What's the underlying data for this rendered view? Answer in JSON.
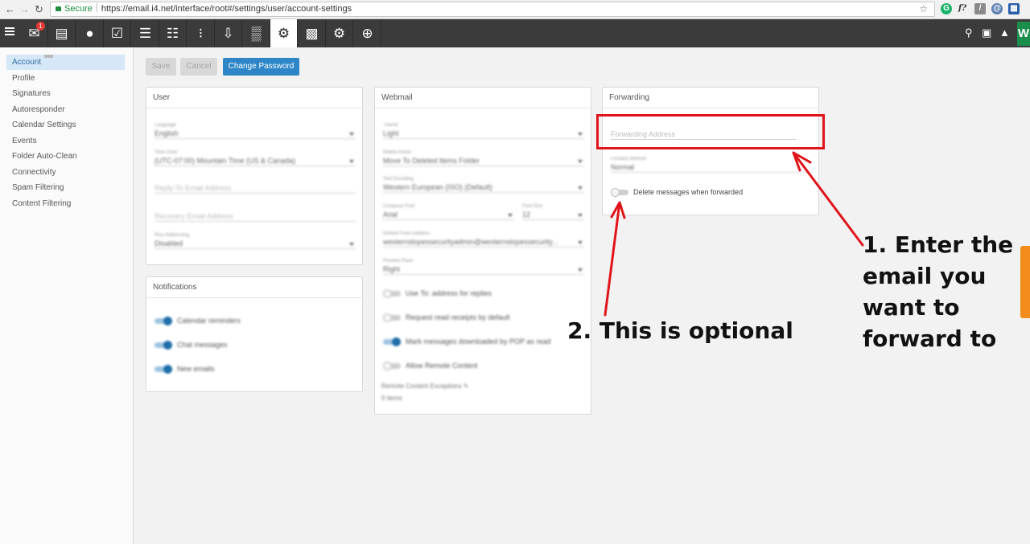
{
  "browser": {
    "secure_label": "Secure",
    "url": "https://email.i4.net/interface/root#/settings/user/account-settings"
  },
  "toolbar": {
    "mail_badge": "1",
    "user_initial": "W"
  },
  "sidebar": {
    "items": [
      {
        "label": "Account"
      },
      {
        "label": "Profile"
      },
      {
        "label": "Signatures"
      },
      {
        "label": "Autoresponder"
      },
      {
        "label": "Calendar Settings"
      },
      {
        "label": "Events"
      },
      {
        "label": "Folder Auto-Clean"
      },
      {
        "label": "Connectivity"
      },
      {
        "label": "Spam Filtering"
      },
      {
        "label": "Content Filtering"
      }
    ]
  },
  "actions": {
    "save": "Save",
    "cancel": "Cancel",
    "change_password": "Change Password"
  },
  "user_panel": {
    "title": "User",
    "language_label": "Language",
    "language_value": "English",
    "timezone_label": "Time Zone",
    "timezone_value": "(UTC-07:00) Mountain Time (US & Canada)",
    "reply_to_placeholder": "Reply-To Email Address",
    "recovery_placeholder": "Recovery Email Address",
    "plus_label": "Plus Addressing",
    "plus_value": "Disabled"
  },
  "notifications_panel": {
    "title": "Notifications",
    "items": [
      {
        "label": "Calendar reminders"
      },
      {
        "label": "Chat messages"
      },
      {
        "label": "New emails"
      }
    ]
  },
  "webmail_panel": {
    "title": "Webmail",
    "theme_label": "Theme",
    "theme_value": "Light",
    "delete_label": "Delete Action",
    "delete_value": "Move To Deleted Items Folder",
    "encoding_label": "Text Encoding",
    "encoding_value": "Western European (ISO) (Default)",
    "font_label": "Compose Font",
    "font_value": "Arial",
    "fontsize_label": "Font Size",
    "fontsize_value": "12",
    "from_label": "Default From Address",
    "from_value": "westernslopessecurityadmin@westernslopessecurity...",
    "preview_label": "Preview Pane",
    "preview_value": "Right",
    "toggles": [
      {
        "label": "Use To: address for replies"
      },
      {
        "label": "Request read receipts by default"
      },
      {
        "label": "Mark messages downloaded by POP as read"
      },
      {
        "label": "Allow Remote Content"
      }
    ],
    "exceptions_label": "Remote Content Exceptions",
    "exceptions_count": "0 items"
  },
  "forwarding_panel": {
    "title": "Forwarding",
    "address_placeholder": "Forwarding Address",
    "method_label": "Forward Method",
    "method_value": "Normal",
    "delete_toggle_label": "Delete messages when forwarded"
  },
  "annotations": {
    "step1_lines": [
      "1. Enter the",
      "email you",
      "want to",
      "forward to"
    ],
    "step2": "2. This is optional"
  },
  "colors": {
    "accent": "#2e86c8",
    "toolbar_bg": "#3b3b3b",
    "annotation_red": "#e0141b"
  }
}
